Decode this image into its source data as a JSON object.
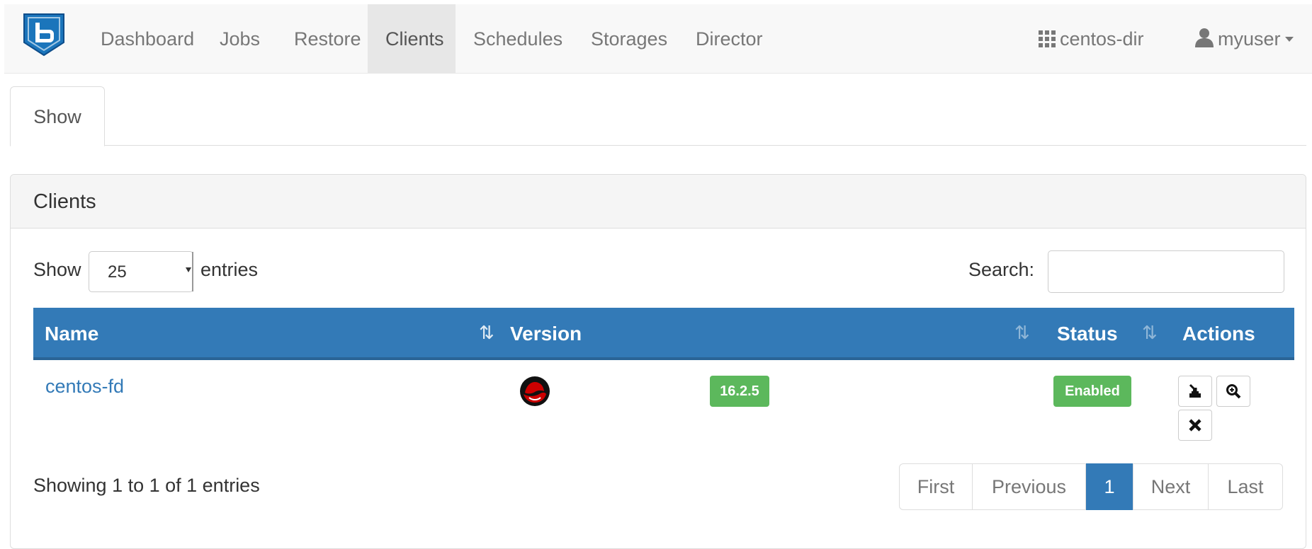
{
  "nav": {
    "items": [
      {
        "label": "Dashboard",
        "active": false
      },
      {
        "label": "Jobs",
        "active": false
      },
      {
        "label": "Restore",
        "active": false
      },
      {
        "label": "Clients",
        "active": true
      },
      {
        "label": "Schedules",
        "active": false
      },
      {
        "label": "Storages",
        "active": false
      },
      {
        "label": "Director",
        "active": false
      }
    ],
    "director_name": "centos-dir",
    "user_name": "myuser",
    "icons": {
      "brand": "bareos-logo",
      "director": "grid-icon",
      "user": "user-icon"
    }
  },
  "tabs": [
    {
      "label": "Show",
      "active": true
    }
  ],
  "panel": {
    "title": "Clients",
    "length": {
      "prefix": "Show",
      "selected": "25",
      "suffix": "entries"
    },
    "search": {
      "label": "Search:",
      "value": "",
      "placeholder": ""
    },
    "columns": [
      "Name",
      "Version",
      "Status",
      "Actions"
    ],
    "rows": [
      {
        "name": "centos-fd",
        "os_icon": "redhat-icon",
        "version": "16.2.5",
        "status": "Enabled",
        "actions": [
          "restore-icon",
          "zoom-in-icon",
          "remove-icon"
        ]
      }
    ],
    "info": "Showing 1 to 1 of 1 entries",
    "pagination": [
      "First",
      "Previous",
      "1",
      "Next",
      "Last"
    ],
    "current_page": "1"
  },
  "colors": {
    "primary": "#337ab7",
    "success": "#5cb85c",
    "navbar_bg": "#f8f8f8",
    "nav_active_bg": "#e7e7e7"
  }
}
